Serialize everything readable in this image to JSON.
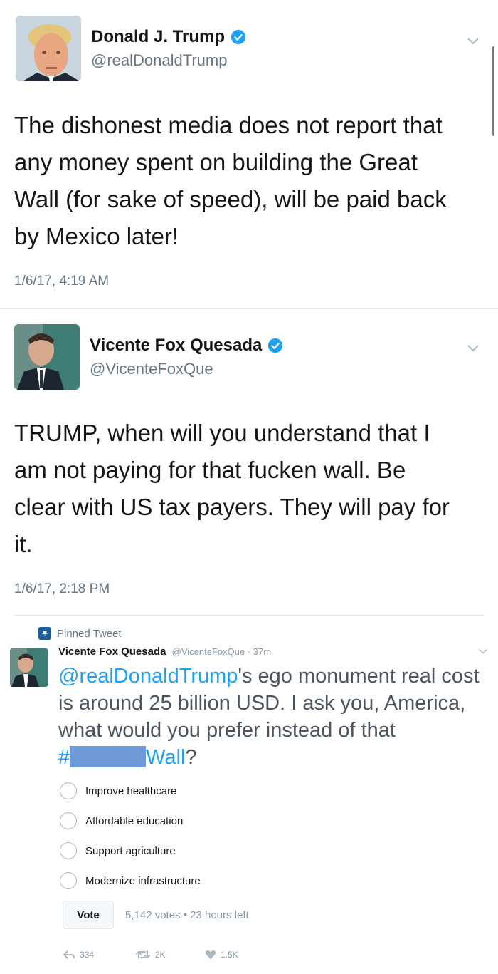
{
  "tweet1": {
    "name": "Donald J. Trump",
    "handle": "@realDonaldTrump",
    "text_lines": [
      "The dishonest media does not report that",
      "any money spent on building the Great",
      "Wall (for sake of speed), will be paid back",
      "by Mexico later!"
    ],
    "timestamp": "1/6/17, 4:19 AM",
    "verified_icon": "verified-badge-icon"
  },
  "tweet2": {
    "name": "Vicente Fox Quesada",
    "handle": "@VicenteFoxQue",
    "text_lines": [
      "TRUMP,  when will you understand that I",
      "am not paying for that fucken wall. Be",
      "clear with US tax payers. They will pay for",
      "it."
    ],
    "timestamp": "1/6/17, 2:18 PM",
    "verified_icon": "verified-badge-icon"
  },
  "pinned": {
    "label": "Pinned Tweet",
    "name": "Vicente Fox Quesada",
    "handle_meta": "@VicenteFoxQue · 37m",
    "mention": "@realDonaldTrump",
    "text_after_mention": "'s ego monument real cost",
    "text_lines": [
      "is around 25 billion USD. I ask you, America,",
      "what would you prefer instead of that"
    ],
    "hash_prefix": "#",
    "hash_suffix": "Wall",
    "hash_trailing": "?",
    "poll_options": [
      "Improve healthcare",
      "Affordable education",
      "Support agriculture",
      "Modernize infrastructure"
    ],
    "vote_label": "Vote",
    "vote_meta": "5,142 votes • 23 hours left",
    "reply_count": "334",
    "retweet_count": "2K",
    "like_count": "1.5K"
  },
  "colors": {
    "link_blue": "#1da1f2",
    "verified_blue": "#1da1f2",
    "redaction": "#6e9bd8",
    "muted_gray": "#657786"
  }
}
